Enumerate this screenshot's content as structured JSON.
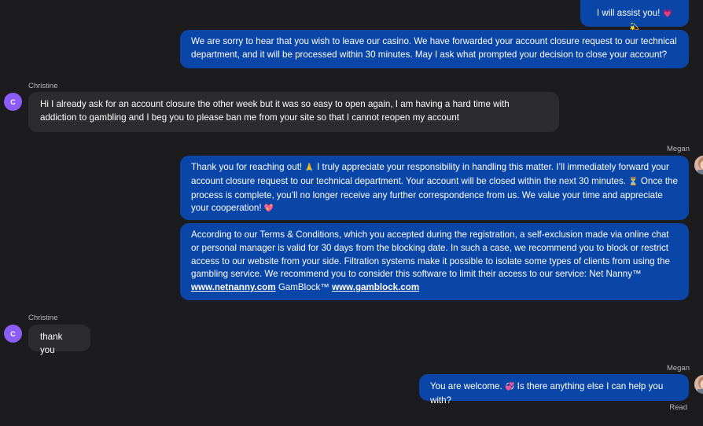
{
  "messages": {
    "m1": {
      "text": "I will assist you!",
      "emoji": "💗 💫"
    },
    "m2": {
      "text": "We are sorry to hear that you wish to leave our casino. We have forwarded your account closure request to our technical department, and it will be processed within 30 minutes. May I ask what prompted your decision to close your account?"
    },
    "m3": {
      "sender": "Christine",
      "avatar_initial": "C",
      "text": "Hi I already ask for an account closure the other week but it was so easy to open again, I am having a hard time with addiction to gambling and I beg you to please ban me from your site so that I cannot reopen my account"
    },
    "m4": {
      "sender": "Megan",
      "t1": "Thank you for reaching out!",
      "e1": "🙏",
      "t2": "I truly appreciate your responsibility in handling this matter. I’ll immediately forward your account closure request to our technical department. Your account will be closed within the next 30 minutes.",
      "e2": "⏳",
      "t3": "Once the process is complete, you’ll no longer receive any further correspondence from us. We value your time and appreciate your cooperation!",
      "e3": "💖"
    },
    "m5": {
      "t1": "According to our Terms & Conditions, which you accepted during the registration, a self-exclusion made via online chat or personal manager is valid for 30 days from the blocking date. In such a case, we recommend you to block or restrict access to our website from your side. Filtration systems make it possible to isolate some types of clients from using the gambling service. We recommend you to consider this software to limit their access to our service: Net Nanny™",
      "link1": "www.netnanny.com",
      "t2": "GamBlock™",
      "link2": "www.gamblock.com"
    },
    "m6": {
      "sender": "Christine",
      "avatar_initial": "C",
      "text": "thank you"
    },
    "m7": {
      "sender": "Megan",
      "t1": "You are welcome.",
      "e1": "💞",
      "t2": "Is there anything else I can help you with?",
      "status": "Read"
    }
  },
  "colors": {
    "background": "#1c1c1e",
    "agent_bubble": "#0a45a8",
    "user_bubble": "#2c2c2e",
    "user_avatar": "#8b5cf6"
  }
}
